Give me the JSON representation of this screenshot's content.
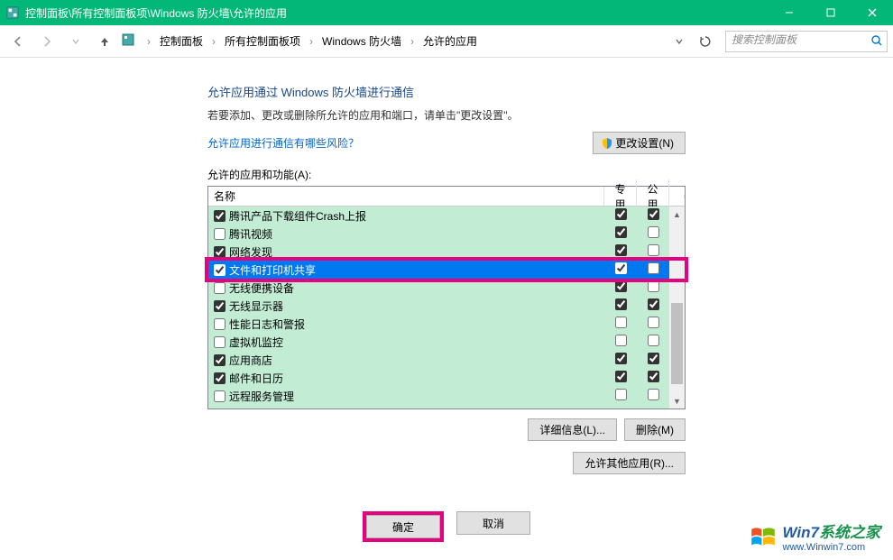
{
  "titlebar": {
    "title": "控制面板\\所有控制面板项\\Windows 防火墙\\允许的应用"
  },
  "breadcrumb": {
    "items": [
      "控制面板",
      "所有控制面板项",
      "Windows 防火墙",
      "允许的应用"
    ]
  },
  "search": {
    "placeholder": "搜索控制面板"
  },
  "panel": {
    "title": "允许应用通过 Windows 防火墙进行通信",
    "desc": "若要添加、更改或删除所允许的应用和端口，请单击\"更改设置\"。",
    "risklink": "允许应用进行通信有哪些风险？",
    "changesettings": "更改设置(N)",
    "listlabel": "允许的应用和功能(A):",
    "col_name": "名称",
    "col_priv": "专用",
    "col_pub": "公用",
    "details": "详细信息(L)...",
    "remove": "删除(M)",
    "allowother": "允许其他应用(R)..."
  },
  "rows": [
    {
      "name": "腾讯产品下载组件Crash上报",
      "on": true,
      "priv": true,
      "pub": true
    },
    {
      "name": "腾讯视频",
      "on": false,
      "priv": true,
      "pub": false
    },
    {
      "name": "网络发现",
      "on": true,
      "priv": true,
      "pub": false
    },
    {
      "name": "文件和打印机共享",
      "on": true,
      "priv": true,
      "pub": false,
      "selected": true
    },
    {
      "name": "无线便携设备",
      "on": false,
      "priv": true,
      "pub": false
    },
    {
      "name": "无线显示器",
      "on": true,
      "priv": true,
      "pub": true
    },
    {
      "name": "性能日志和警报",
      "on": false,
      "priv": false,
      "pub": false
    },
    {
      "name": "虚拟机监控",
      "on": false,
      "priv": false,
      "pub": false
    },
    {
      "name": "应用商店",
      "on": true,
      "priv": true,
      "pub": true
    },
    {
      "name": "邮件和日历",
      "on": true,
      "priv": true,
      "pub": true
    },
    {
      "name": "远程服务管理",
      "on": false,
      "priv": false,
      "pub": false
    }
  ],
  "footer": {
    "ok": "确定",
    "cancel": "取消"
  },
  "watermark": {
    "brand_n": "Win7",
    "brand_suf": "系统之家",
    "url": "www.Winwin7.com"
  }
}
